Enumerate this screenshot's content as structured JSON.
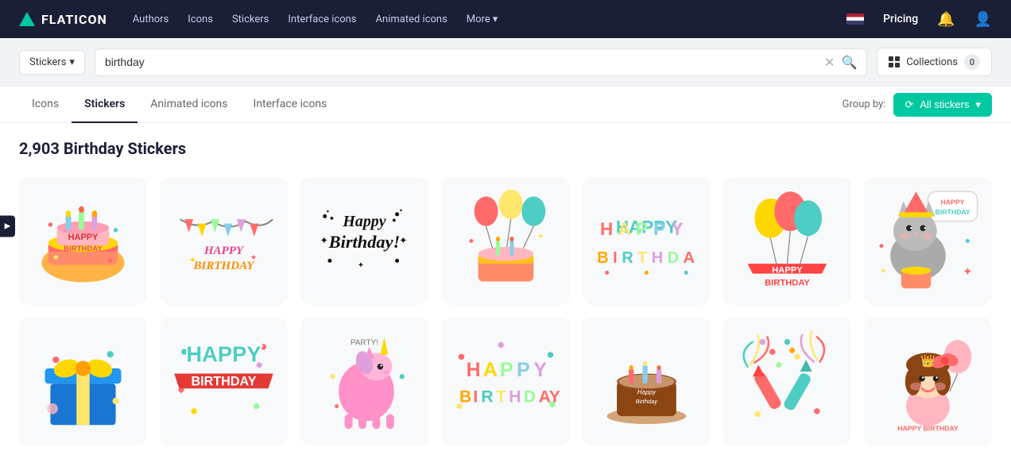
{
  "nav": {
    "logo_text": "FLATICON",
    "links": [
      "Authors",
      "Icons",
      "Stickers",
      "Interface icons",
      "Animated icons",
      "More"
    ],
    "pricing": "Pricing"
  },
  "searchbar": {
    "filter_label": "Stickers",
    "query": "birthday",
    "clear_title": "Clear",
    "collections_label": "Collections",
    "collections_count": "0"
  },
  "tabs": {
    "items": [
      "Icons",
      "Stickers",
      "Animated icons",
      "Interface icons"
    ],
    "active": "Stickers",
    "groupby_label": "Group by:",
    "groupby_value": "All stickers"
  },
  "results": {
    "count": "2,903",
    "title": "Birthday Stickers"
  },
  "stickers_row1": [
    {
      "id": "s1",
      "alt": "Happy Birthday cake with candles"
    },
    {
      "id": "s2",
      "alt": "Happy Birthday banner bunting"
    },
    {
      "id": "s3",
      "alt": "Happy Birthday calligraphy black"
    },
    {
      "id": "s4",
      "alt": "Birthday cake with balloons"
    },
    {
      "id": "s5",
      "alt": "Happy Birthday colorful letters"
    },
    {
      "id": "s6",
      "alt": "Balloons Happy Birthday"
    },
    {
      "id": "s7",
      "alt": "Cat with birthday cake"
    }
  ],
  "stickers_row2": [
    {
      "id": "s8",
      "alt": "Birthday gift box blue"
    },
    {
      "id": "s9",
      "alt": "Happy Birthday ribbon red"
    },
    {
      "id": "s10",
      "alt": "Party unicorn balloon pink"
    },
    {
      "id": "s11",
      "alt": "Happy Birthday colorful text"
    },
    {
      "id": "s12",
      "alt": "Birthday cake chocolate"
    },
    {
      "id": "s13",
      "alt": "Birthday confetti crackers"
    },
    {
      "id": "s14",
      "alt": "Girl Happy Birthday"
    }
  ]
}
